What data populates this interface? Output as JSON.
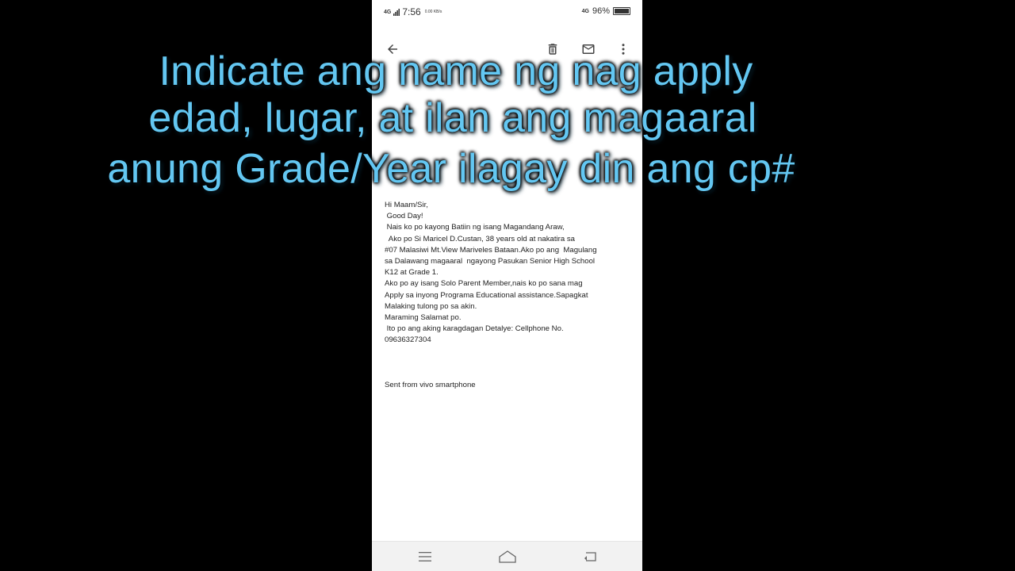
{
  "status_bar": {
    "signal": "4G",
    "time": "7:56",
    "speed": "0.00 KB/s",
    "network": "4G",
    "battery": "96%"
  },
  "toolbar": {
    "back_icon": "arrow-left-icon",
    "delete_icon": "trash-icon",
    "mail_icon": "envelope-icon",
    "more_icon": "more-vert-icon"
  },
  "email": {
    "body": "Hi Maam/Sir,\n Good Day!\n Nais ko po kayong Batiin ng isang Magandang Araw,\n  Ako po Si Maricel D.Custan, 38 years old at nakatira sa\n#07 Malasiwi Mt.View Mariveles Bataan.Ako po ang  Magulang\nsa Dalawang magaaral  ngayong Pasukan Senior High School\nK12 at Grade 1.\nAko po ay isang Solo Parent Member,nais ko po sana mag\nApply sa inyong Programa Educational assistance.Sapagkat\nMalaking tulong po sa akin.\nMaraming Salamat po.\n Ito po ang aking karagdagan Detalye: Cellphone No.\n09636327304",
    "signature": "Sent from vivo smartphone"
  },
  "overlay": {
    "line1": "Indicate ang name ng nag apply",
    "line2": "edad, lugar, at ilan ang magaaral",
    "line3": "anung Grade/Year ilagay din ang cp#"
  },
  "nav_bar": {
    "menu_icon": "menu-lines-icon",
    "home_icon": "home-icon",
    "back_icon": "back-arrow-icon"
  },
  "colors": {
    "overlay_text": "#63c7f2",
    "background": "#000000",
    "screen": "#ffffff"
  }
}
